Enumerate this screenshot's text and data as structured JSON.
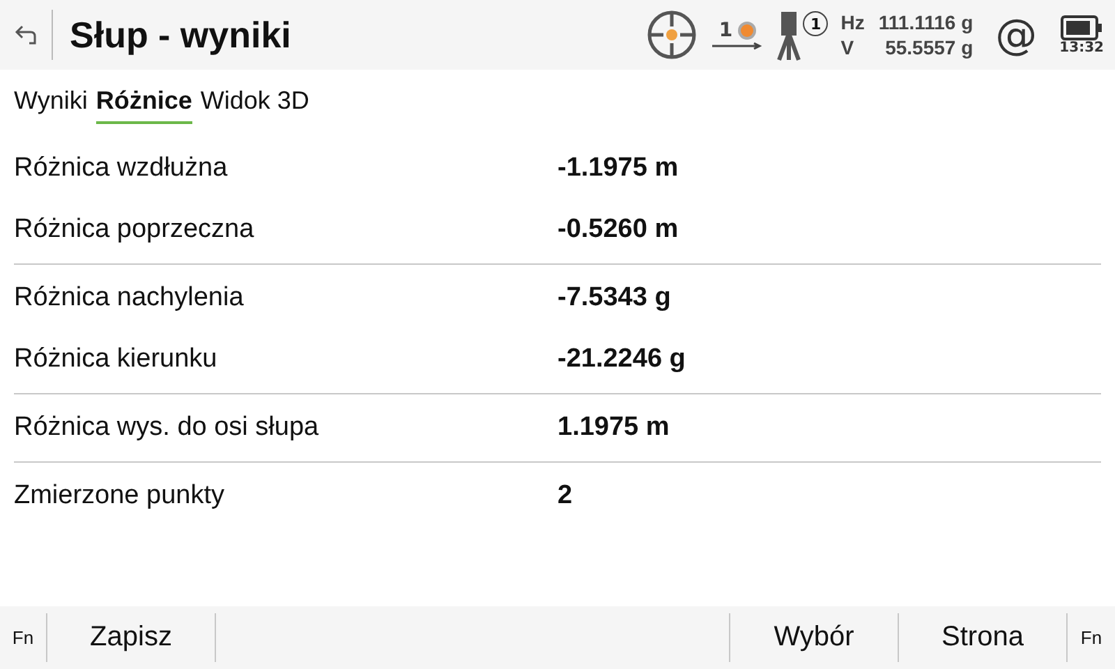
{
  "header": {
    "title": "Słup - wyniki",
    "status": {
      "prism_count": "1",
      "instrument_badge": "1",
      "hz_label": "Hz",
      "hz_value": "111.1116 g",
      "v_label": "V",
      "v_value": "55.5557 g",
      "at": "@",
      "time": "13:32"
    }
  },
  "tabs": [
    {
      "label": "Wyniki",
      "selected": false
    },
    {
      "label": "Różnice",
      "selected": true
    },
    {
      "label": "Widok 3D",
      "selected": false
    }
  ],
  "groups": [
    {
      "rows": [
        {
          "label": "Różnica wzdłużna",
          "value": "-1.1975 m"
        },
        {
          "label": "Różnica poprzeczna",
          "value": "-0.5260 m"
        }
      ]
    },
    {
      "rows": [
        {
          "label": "Różnica nachylenia",
          "value": "-7.5343 g"
        },
        {
          "label": "Różnica kierunku",
          "value": "-21.2246 g"
        }
      ]
    },
    {
      "rows": [
        {
          "label": "Różnica wys. do osi słupa",
          "value": "1.1975 m"
        }
      ]
    },
    {
      "rows": [
        {
          "label": "Zmierzone punkty",
          "value": "2"
        }
      ]
    }
  ],
  "softkeys": [
    {
      "kind": "fn",
      "label": "Fn"
    },
    {
      "kind": "key",
      "label": "Zapisz"
    },
    {
      "kind": "blank"
    },
    {
      "kind": "key",
      "label": "Wybór"
    },
    {
      "kind": "key",
      "label": "Strona"
    },
    {
      "kind": "fn",
      "label": "Fn"
    }
  ]
}
